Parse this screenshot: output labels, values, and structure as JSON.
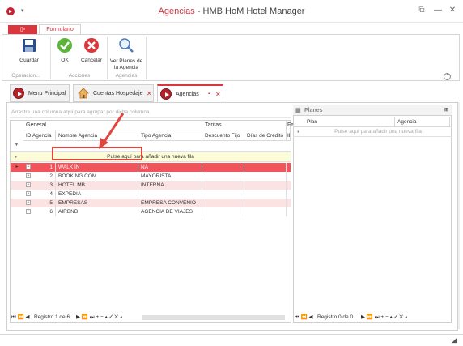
{
  "window": {
    "title_accent": "Agencias",
    "title_rest": " - HMB HoM Hotel Manager",
    "qat_arrow": "▾",
    "restore_icon": "⧉",
    "minimize_icon": "—",
    "close_icon": "✕"
  },
  "ribbon": {
    "file_tab_label": "▯▫",
    "tab_label": "Formulario",
    "buttons": {
      "guardar": "Guardar",
      "ok": "OK",
      "cancelar": "Cancelar",
      "ver_planes": "Ver Planes de la Agencia"
    },
    "groups": {
      "operacion": "Operacion...",
      "acciones": "Acciones",
      "agencias": "Agencias"
    }
  },
  "doc_tabs": [
    {
      "label": "Menu Principal"
    },
    {
      "label": "Cuentas Hospedaje",
      "close": "✕"
    },
    {
      "label": "Agencias",
      "pin": "▪",
      "close": "✕"
    }
  ],
  "grid": {
    "group_panel_text": "Arrastre una columna aquí para agrupar por dicha columna",
    "bands": [
      "General",
      "Tarifas",
      "Fa"
    ],
    "columns": [
      "ID Agencia",
      "Nombre Agencia",
      "Tipo Agencia",
      "Descuento Fijo",
      "Días de Crédito",
      "ID"
    ],
    "filter_row_icon": "▼",
    "new_row_icon": "●",
    "new_row_text": "Pulse aquí para añadir una nueva fila",
    "rows": [
      {
        "id": "1",
        "nombre": "WALK IN",
        "tipo": "NA"
      },
      {
        "id": "2",
        "nombre": "BOOKING.COM",
        "tipo": "MAYORISTA"
      },
      {
        "id": "3",
        "nombre": "HOTEL MB",
        "tipo": "INTERNA"
      },
      {
        "id": "4",
        "nombre": "EXPEDIA",
        "tipo": ""
      },
      {
        "id": "5",
        "nombre": "EMPRESAS",
        "tipo": "EMPRESA CONVENIO"
      },
      {
        "id": "6",
        "nombre": "AIRBNB",
        "tipo": "AGENCIA DE VIAJES"
      }
    ],
    "nav_buttons_left": "⏮ ⏪ ◀",
    "record_text": "Registro 1 de 6",
    "nav_buttons_right": "▶ ⏩ ⏭ + − ▴ ✓ ✕ ◂"
  },
  "planes": {
    "title": "Planes",
    "pin_icon": "⊞",
    "columns": [
      "Plan",
      "Agencia"
    ],
    "new_row_icon": "●",
    "new_row_text": "Pulse aquí para añadir una nueva fila",
    "nav_buttons_left": "⏮ ⏪ ◀",
    "record_text": "Registro 0 de 0",
    "nav_buttons_right": "▶ ⏩ ⏭ + − ▴ ✓ ✕ ◂"
  },
  "colors": {
    "accent": "#d9363e",
    "selected_row": "#f0555b",
    "alt_row": "#fbe3e4",
    "new_row": "#fdfcd8"
  }
}
